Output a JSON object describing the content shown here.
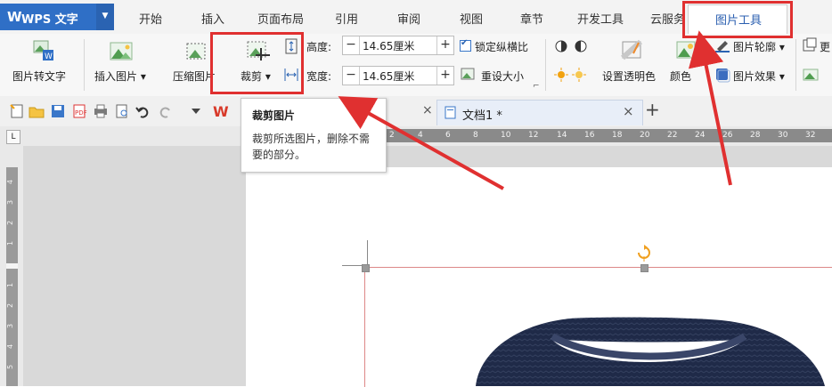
{
  "app": {
    "logo": "W",
    "name": "WPS 文字",
    "dropdown": "▼"
  },
  "menu_tabs": [
    "开始",
    "插入",
    "页面布局",
    "引用",
    "审阅",
    "视图",
    "章节",
    "开发工具",
    "云服务",
    "图片工具"
  ],
  "ribbon": {
    "pic_to_text": "图片转文字",
    "insert_pic": "插入图片",
    "insert_pic_arrow": "▾",
    "compress_pic": "压缩图片",
    "crop": "裁剪",
    "crop_arrow": "▾",
    "height_label": "高度:",
    "height_value": "14.65厘米",
    "width_label": "宽度:",
    "width_value": "14.65厘米",
    "minus": "−",
    "plus": "+",
    "lock_ratio": "锁定纵横比",
    "reset_size": "重设大小",
    "set_transparent": "设置透明色",
    "color": "颜色",
    "pic_outline": "图片轮廓",
    "pic_effect": "图片效果",
    "dropdown_arrow": "▾",
    "more1": "更",
    "dialog_launcher": "⌐"
  },
  "doc_tab": {
    "title": "文档1 *",
    "close": "×"
  },
  "other_tab_close": "×",
  "new_tab": "+",
  "tooltip": {
    "title": "裁剪图片",
    "desc": "裁剪所选图片，删除不需要的部分。"
  },
  "ruler_h": [
    "2",
    "4",
    "6",
    "8",
    "10",
    "12",
    "14",
    "16",
    "18",
    "20",
    "22",
    "24",
    "26",
    "28",
    "30",
    "32"
  ],
  "ruler_v_top": [
    "4",
    "3",
    "2",
    "1"
  ],
  "ruler_v_bottom": [
    "1",
    "2",
    "3",
    "4",
    "5"
  ],
  "ruler_corner": "L",
  "colors": {
    "accent": "#2f6fc6",
    "highlight": "#e03030",
    "sweater": "#1f2a48"
  }
}
